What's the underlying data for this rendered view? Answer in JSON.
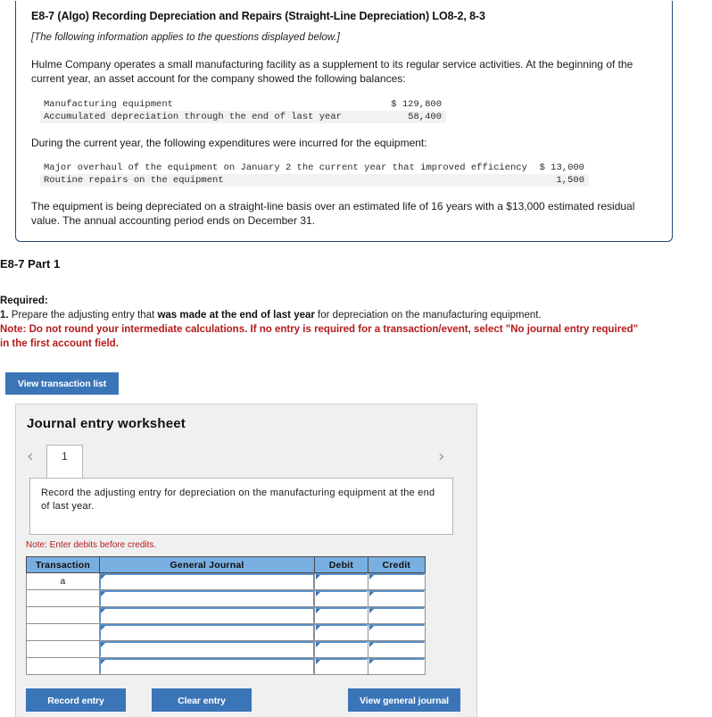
{
  "info_box": {
    "exercise_title": "E8-7 (Algo) Recording Depreciation and Repairs (Straight-Line Depreciation) LO8-2, 8-3",
    "applies_note": "[The following information applies to the questions displayed below.]",
    "paragraph_1": "Hulme Company operates a small manufacturing facility as a supplement to its regular service activities. At the beginning of the current year, an asset account for the company showed the following balances:",
    "balances_table": [
      {
        "label": "Manufacturing equipment",
        "value": "$ 129,800"
      },
      {
        "label": "Accumulated depreciation through the end of last year",
        "value": "58,400"
      }
    ],
    "paragraph_2": "During the current year, the following expenditures were incurred for the equipment:",
    "expenditures_table": [
      {
        "label": "Major overhaul of the equipment on January 2 the current year that improved efficiency",
        "value": "$ 13,000"
      },
      {
        "label": "Routine repairs on the equipment",
        "value": "1,500"
      }
    ],
    "paragraph_3": "The equipment is being depreciated on a straight-line basis over an estimated life of 16 years with a $13,000 estimated residual value. The annual accounting period ends on December 31."
  },
  "part": {
    "heading": "E8-7 Part 1"
  },
  "required": {
    "label": "Required:",
    "item_number": "1.",
    "item_text_before": " Prepare the adjusting entry that ",
    "item_text_bold": "was made at the end of last year",
    "item_text_after": " for depreciation on the manufacturing equipment.",
    "red_note": "Note: Do not round your intermediate calculations. If no entry is required for a transaction/event, select \"No journal entry required\" in the first account field."
  },
  "buttons": {
    "view_transaction_list": "View transaction list",
    "record_entry": "Record entry",
    "clear_entry": "Clear entry",
    "view_general_journal": "View general journal"
  },
  "worksheet": {
    "title": "Journal entry worksheet",
    "prev_icon": "chevron-left-icon",
    "next_icon": "chevron-right-icon",
    "current_page": "1",
    "description": "Record the adjusting entry for depreciation on the manufacturing equipment at the end of last year.",
    "note_debits": "Note: Enter debits before credits.",
    "table": {
      "headers": [
        "Transaction",
        "General Journal",
        "Debit",
        "Credit"
      ],
      "rows": [
        {
          "transaction": "a",
          "general_journal": "",
          "debit": "",
          "credit": ""
        },
        {
          "transaction": "",
          "general_journal": "",
          "debit": "",
          "credit": ""
        },
        {
          "transaction": "",
          "general_journal": "",
          "debit": "",
          "credit": ""
        },
        {
          "transaction": "",
          "general_journal": "",
          "debit": "",
          "credit": ""
        },
        {
          "transaction": "",
          "general_journal": "",
          "debit": "",
          "credit": ""
        },
        {
          "transaction": "",
          "general_journal": "",
          "debit": "",
          "credit": ""
        }
      ]
    }
  },
  "colors": {
    "info_border": "#1f4e79",
    "button_blue": "#3a75b8",
    "table_header_blue": "#79aee0",
    "note_red": "#b51b1b",
    "panel_gray": "#f0f0f0"
  }
}
